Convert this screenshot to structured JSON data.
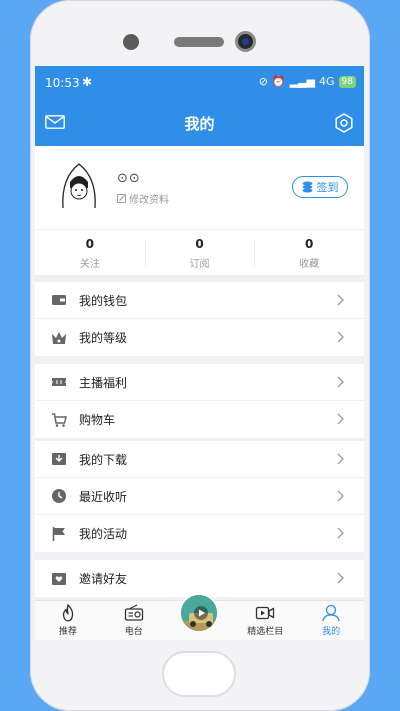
{
  "status": {
    "time": "10:53",
    "network": "4G",
    "battery": "98"
  },
  "header": {
    "title": "我的"
  },
  "profile": {
    "nickname": "⊙⊙",
    "edit_label": "修改资料",
    "checkin_label": "签到"
  },
  "stats": [
    {
      "value": "0",
      "label": "关注"
    },
    {
      "value": "0",
      "label": "订阅"
    },
    {
      "value": "0",
      "label": "收藏"
    }
  ],
  "menu": {
    "wallet": "我的钱包",
    "level": "我的等级",
    "anchor_welfare": "主播福利",
    "cart": "购物车",
    "downloads": "我的下载",
    "recent": "最近收听",
    "activities": "我的活动",
    "invite": "邀请好友"
  },
  "tabs": {
    "recommend": "推荐",
    "radio": "电台",
    "featured": "精选栏目",
    "mine": "我的"
  },
  "colors": {
    "primary": "#2f8ee8",
    "background": "#5aa8f4"
  }
}
